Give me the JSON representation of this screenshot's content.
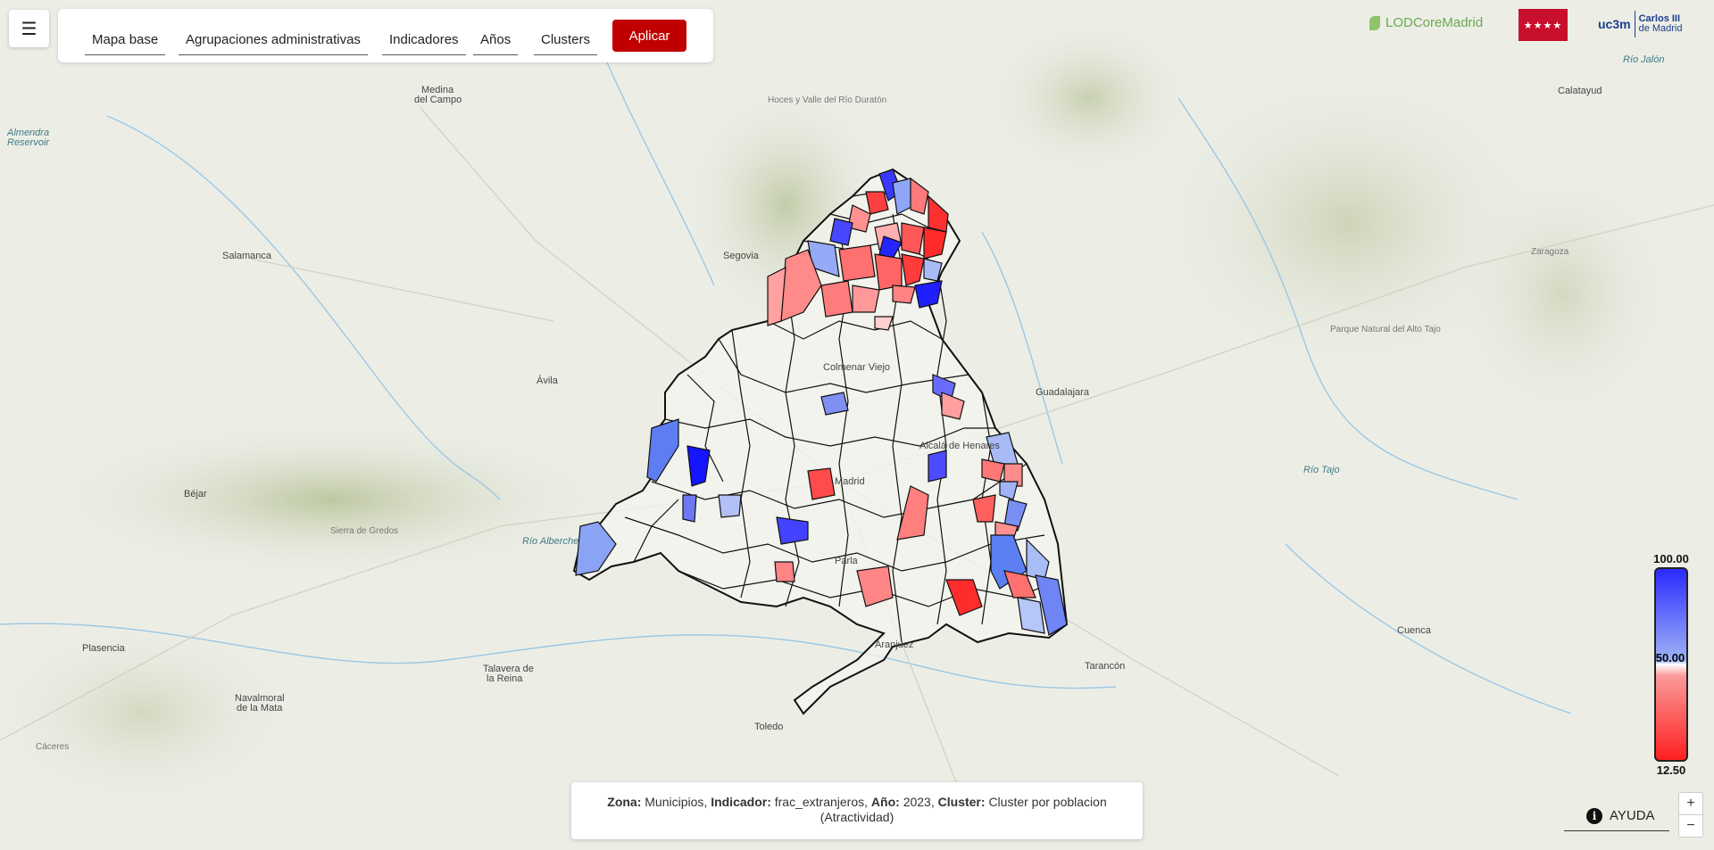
{
  "toolbar": {
    "menu_icon": "☰",
    "items": [
      "Mapa base",
      "Agrupaciones administrativas",
      "Indicadores",
      "Años",
      "Clusters"
    ],
    "apply_label": "Aplicar"
  },
  "logos": {
    "lodcore": "LODCoreMadrid",
    "uc3m_line1": "uc3m",
    "uc3m_line2": "Carlos III",
    "uc3m_line3": "de Madrid",
    "cam": "★★★★"
  },
  "legend": {
    "max": "100.00",
    "mid": "50.00",
    "min": "12.50"
  },
  "info": {
    "zona_label": "Zona:",
    "zona": "Municipios,",
    "indicador_label": "Indicador:",
    "indicador": "frac_extranjeros,",
    "anio_label": "Año:",
    "anio": "2023,",
    "cluster_label": "Cluster:",
    "cluster": "Cluster por poblacion",
    "cluster_sub": "(Atractividad)"
  },
  "help_label": "AYUDA",
  "zoom": {
    "in": "+",
    "out": "−"
  },
  "colors": {
    "accent": "#c00000",
    "high": "#2a2aff",
    "low": "#ff1f1f"
  },
  "places": {
    "madrid": "Madrid",
    "segovia": "Segovia",
    "avila": "Ávila",
    "guadalajara": "Guadalajara",
    "toledo": "Toledo",
    "salamanca": "Salamanca",
    "talavera1": "Talavera de",
    "talavera2": "la Reina",
    "tarancon": "Tarancón",
    "cuenca": "Cuenca",
    "calatayud": "Calatayud",
    "plasencia": "Plasencia",
    "bejar": "Béjar",
    "medina1": "Medina",
    "medina2": "del Campo",
    "navalmoral1": "Navalmoral",
    "navalmoral2": "de la Mata",
    "aranjuez": "Aranjuez",
    "alcala": "Alcalá de Henares",
    "parla": "Parla",
    "colmenar": "Colmenar Viejo",
    "zaragoza": "Zaragoza",
    "almendra1": "Almendra",
    "almendra2": "Reservoir",
    "rio_duraton": "Hoces y Valle del Río Duratón",
    "sierra_gredos": "Sierra de Gredos",
    "alto_tajo": "Parque Natural del Alto Tajo",
    "rio_tajo": "Río Tajo",
    "rio_jalon": "Río Jalón",
    "rio_alberche": "Río Alberche",
    "caceres": "Cáceres"
  }
}
